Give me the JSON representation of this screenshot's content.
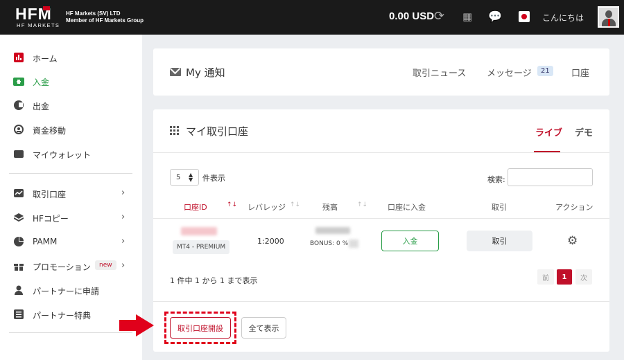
{
  "header": {
    "logo": "HFM",
    "logo_sub": "HF MARKETS",
    "company_line1": "HF Markets (SV) LTD",
    "company_line2": "Member of HF Markets Group",
    "balance": "0.00 USD",
    "greeting": "こんにちは"
  },
  "sidebar": {
    "items": [
      {
        "label": "ホーム"
      },
      {
        "label": "入金"
      },
      {
        "label": "出金"
      },
      {
        "label": "資金移動"
      },
      {
        "label": "マイウォレット"
      },
      {
        "label": "取引口座"
      },
      {
        "label": "HFコピー"
      },
      {
        "label": "PAMM"
      },
      {
        "label": "プロモーション",
        "badge": "new"
      },
      {
        "label": "パートナーに申請"
      },
      {
        "label": "パートナー特典"
      }
    ]
  },
  "notifications": {
    "title": "My 通知",
    "tabs": [
      "取引ニュース",
      "メッセージ",
      "口座"
    ],
    "message_count": "21"
  },
  "accounts": {
    "title": "マイ取引口座",
    "tab_live": "ライブ",
    "tab_demo": "デモ",
    "page_size": "5",
    "page_size_suffix": "件表示",
    "search_label": "検索:",
    "columns": [
      "口座ID",
      "レバレッジ",
      "残高",
      "口座に入金",
      "取引",
      "アクション"
    ],
    "rows": [
      {
        "account_type": "MT4 - PREMIUM",
        "leverage": "1:2000",
        "bonus": "BONUS: 0 %",
        "deposit_label": "入金",
        "trade_label": "取引"
      }
    ],
    "info": "1 件中 1 から 1 まで表示",
    "pager": {
      "prev": "前",
      "current": "1",
      "next": "次"
    },
    "open_account_label": "取引口座開設",
    "show_all_label": "全て表示"
  },
  "colors": {
    "accent_red": "#c0102a",
    "active_green": "#2a9d48",
    "annotation_red": "#e0001b"
  }
}
